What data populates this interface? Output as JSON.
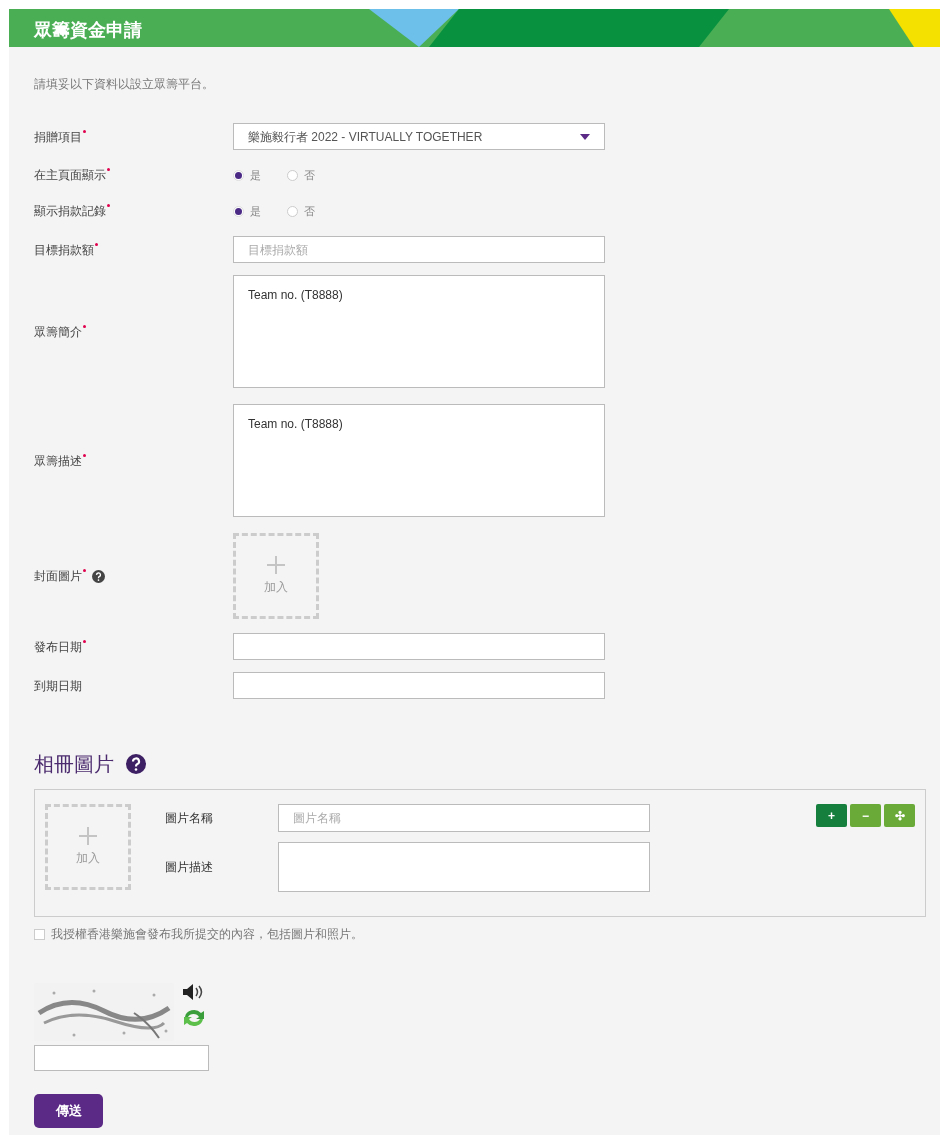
{
  "header": {
    "title": "眾籌資金申請"
  },
  "intro": "請填妥以下資料以設立眾籌平台。",
  "fields": [
    {
      "kind": "select",
      "label": "捐贈項目",
      "required": true,
      "value": "樂施毅行者 2022 - VIRTUALLY TOGETHER"
    },
    {
      "kind": "radio",
      "label": "在主頁面顯示",
      "required": true,
      "options": [
        {
          "label": "是",
          "selected": true
        },
        {
          "label": "否",
          "selected": false
        }
      ]
    },
    {
      "kind": "radio",
      "label": "顯示捐款記錄",
      "required": true,
      "options": [
        {
          "label": "是",
          "selected": true
        },
        {
          "label": "否",
          "selected": false
        }
      ]
    },
    {
      "kind": "text",
      "label": "目標捐款額",
      "required": true,
      "placeholder": "目標捐款額"
    },
    {
      "kind": "textarea",
      "label": "眾籌簡介",
      "required": true,
      "value": "Team no. (T8888)"
    },
    {
      "kind": "textarea",
      "label": "眾籌描述",
      "required": true,
      "value": "Team no. (T8888)"
    },
    {
      "kind": "upload",
      "label": "封面圖片",
      "required": true,
      "help": true,
      "button": "加入"
    },
    {
      "kind": "text",
      "label": "發布日期",
      "required": true
    },
    {
      "kind": "text",
      "label": "到期日期",
      "required": false
    }
  ],
  "gallery": {
    "title": "相冊圖片",
    "upload_label": "加入",
    "name_label": "圖片名稱",
    "name_placeholder": "圖片名稱",
    "description_label": "圖片描述",
    "buttons": [
      {
        "label": "+",
        "color": "#15803d"
      },
      {
        "label": "−",
        "color": "#6aaa38"
      },
      {
        "label": "✣",
        "color": "#6aaa38"
      }
    ]
  },
  "consent": {
    "label": "我授權香港樂施會發布我所提交的內容，包括圖片和照片。",
    "checked": false
  },
  "submit": "傳送"
}
